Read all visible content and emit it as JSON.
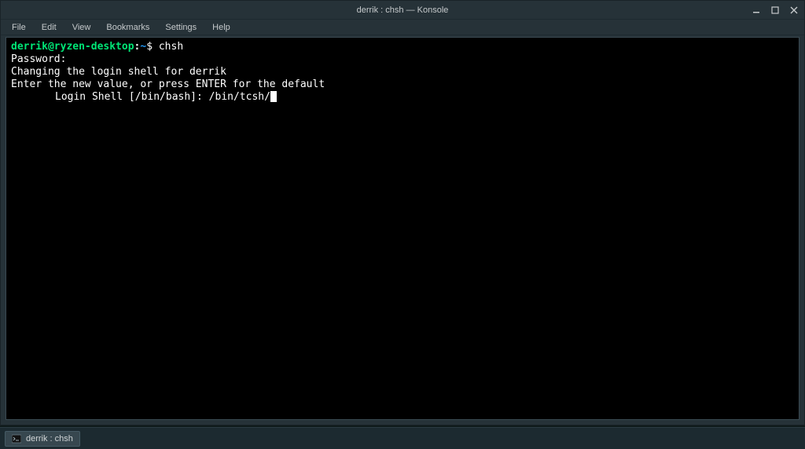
{
  "window": {
    "title": "derrik : chsh — Konsole"
  },
  "menubar": {
    "items": [
      "File",
      "Edit",
      "View",
      "Bookmarks",
      "Settings",
      "Help"
    ]
  },
  "terminal": {
    "prompt": {
      "userhost": "derrik@ryzen-desktop",
      "path": "~",
      "symbol": "$"
    },
    "command": "chsh",
    "lines": {
      "password": "Password:",
      "changing": "Changing the login shell for derrik",
      "enter": "Enter the new value, or press ENTER for the default",
      "login_prompt": "Login Shell [/bin/bash]: ",
      "input_value": "/bin/tcsh/"
    }
  },
  "taskbar": {
    "item_label": "derrik : chsh"
  }
}
